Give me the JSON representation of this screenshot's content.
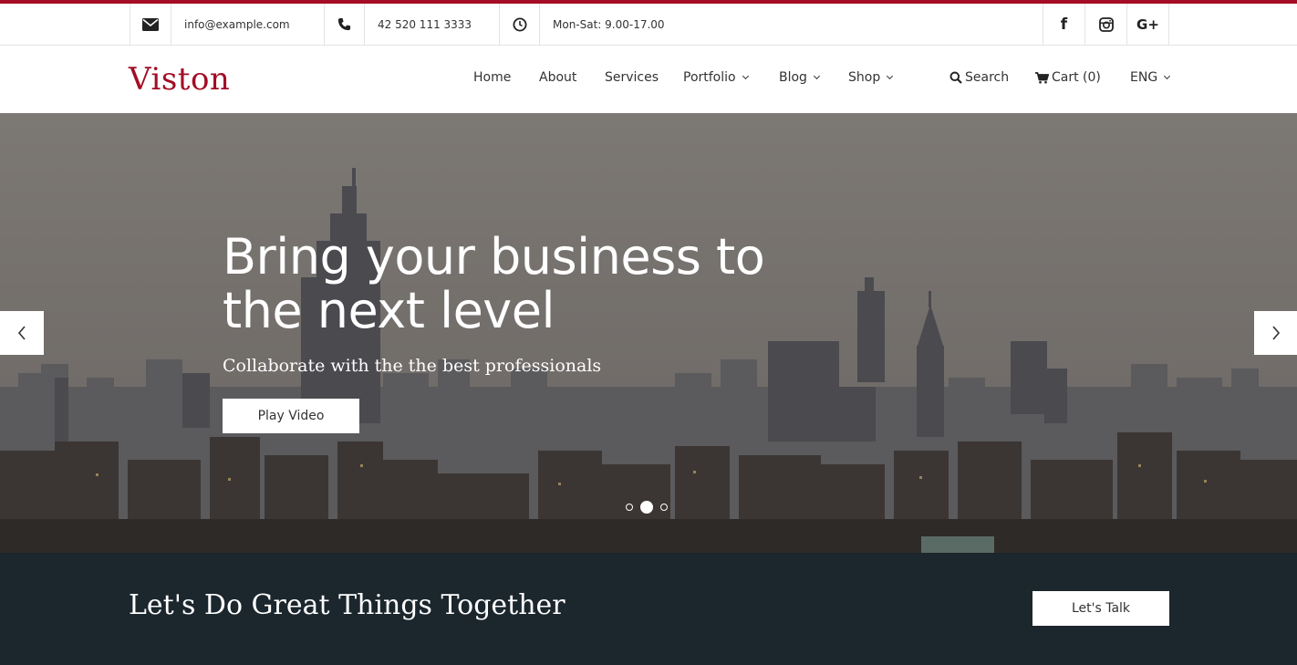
{
  "topbar": {
    "email": "info@example.com",
    "phone": "42 520 111 3333",
    "hours": "Mon-Sat: 9.00-17.00",
    "icons": [
      "envelope-icon",
      "phone-icon",
      "clock-icon"
    ],
    "social": [
      "facebook-icon",
      "instagram-icon",
      "google-plus-icon"
    ],
    "social_labels": {
      "facebook": "f",
      "google_plus": "G+"
    }
  },
  "brand": {
    "name": "Viston",
    "color": "#a30d25"
  },
  "nav": {
    "home": "Home",
    "about": "About",
    "services": "Services",
    "portfolio": "Portfolio",
    "blog": "Blog",
    "shop": "Shop",
    "search": "Search",
    "cart": "Cart (0)",
    "language": "ENG"
  },
  "hero": {
    "title": "Bring your business to the next level",
    "subtitle": "Collaborate with the the best professionals",
    "button": "Play Video",
    "slide_count": 3,
    "active_slide": 2
  },
  "cta": {
    "title": "Let's Do Great Things Together",
    "button": "Let's Talk",
    "background": "#1b262d"
  }
}
